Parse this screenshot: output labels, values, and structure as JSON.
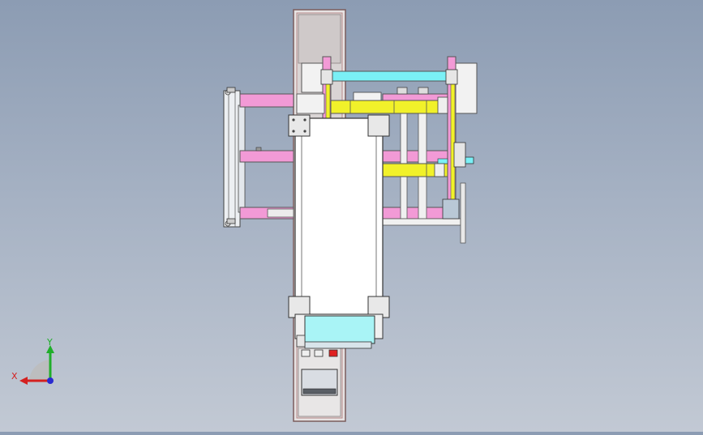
{
  "viewport": {
    "background_top": "#8c9cb3",
    "background_bottom": "#c2c9d4"
  },
  "triad": {
    "x_label": "X",
    "y_label": "Y",
    "x_color": "#d42020",
    "y_color": "#1fae2a",
    "z_color": "#2a2ad0"
  },
  "part_colors": {
    "frame_outline": "#b88a8a",
    "pink_beam": "#f29ad6",
    "yellow_beam": "#f1f12a",
    "cyan_part": "#a9f4f6",
    "cyan_bar": "#7af0f6",
    "panel_grey": "#d9dde3",
    "dark_grey": "#5a5f66",
    "red_button": "#e02020"
  }
}
